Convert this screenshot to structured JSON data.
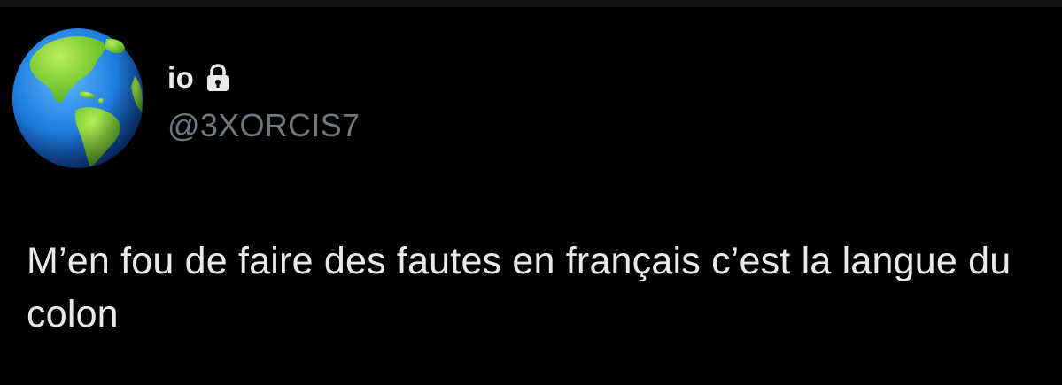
{
  "user": {
    "display_name": "io",
    "handle": "@3XORCIS7",
    "protected_icon": "lock-icon",
    "avatar_icon": "globe-americas-icon"
  },
  "tweet": {
    "text": "M’en fou de faire des fautes en français c’est la langue du colon"
  },
  "colors": {
    "background": "#000000",
    "primary_text": "#e7e9ea",
    "secondary_text": "#71767b"
  }
}
